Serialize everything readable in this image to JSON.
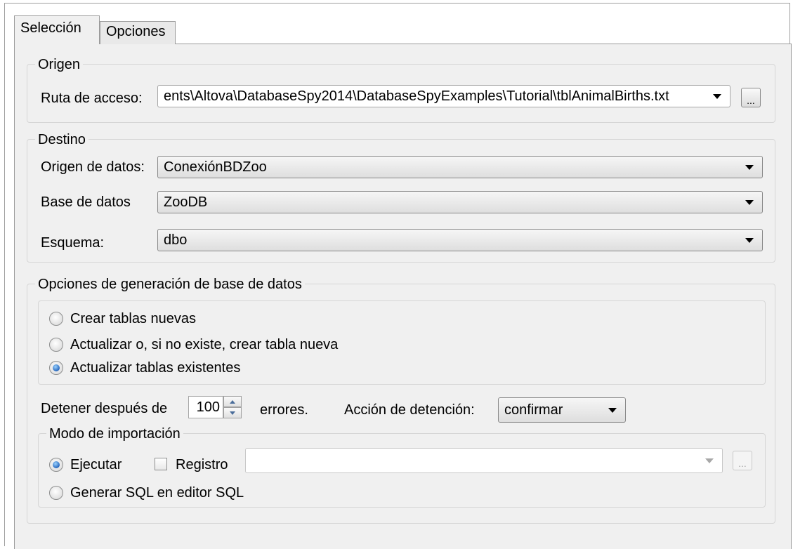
{
  "tabs": {
    "seleccion": "Selección",
    "opciones": "Opciones"
  },
  "origen": {
    "legend": "Origen",
    "ruta_label": "Ruta de acceso:",
    "ruta_value": "ents\\Altova\\DatabaseSpy2014\\DatabaseSpyExamples\\Tutorial\\tblAnimalBirths.txt",
    "browse_label": "..."
  },
  "destino": {
    "legend": "Destino",
    "origen_datos_label": "Origen de datos:",
    "origen_datos_value": "ConexiónBDZoo",
    "base_datos_label": "Base de datos",
    "base_datos_value": "ZooDB",
    "esquema_label": "Esquema:",
    "esquema_value": "dbo"
  },
  "generacion": {
    "legend": "Opciones de generación de base de datos",
    "options": [
      {
        "label": "Crear tablas nuevas",
        "selected": false
      },
      {
        "label": "Actualizar o, si no existe, crear tabla nueva",
        "selected": false
      },
      {
        "label": "Actualizar tablas existentes",
        "selected": true
      }
    ],
    "detener_label": "Detener después de",
    "detener_value": "100",
    "errores_label": "errores.",
    "accion_label": "Acción de detención:",
    "accion_value": "confirmar"
  },
  "modo": {
    "legend": "Modo de importación",
    "ejecutar_label": "Ejecutar",
    "ejecutar_selected": true,
    "registro_label": "Registro",
    "registro_checked": false,
    "registro_path": "",
    "browse_label": "...",
    "generar_label": "Generar SQL en editor SQL",
    "generar_selected": false
  },
  "colors": {
    "panel_bg": "#f0f0f0",
    "border": "#9c9c9c",
    "radio_accent": "#1f5fb8"
  }
}
